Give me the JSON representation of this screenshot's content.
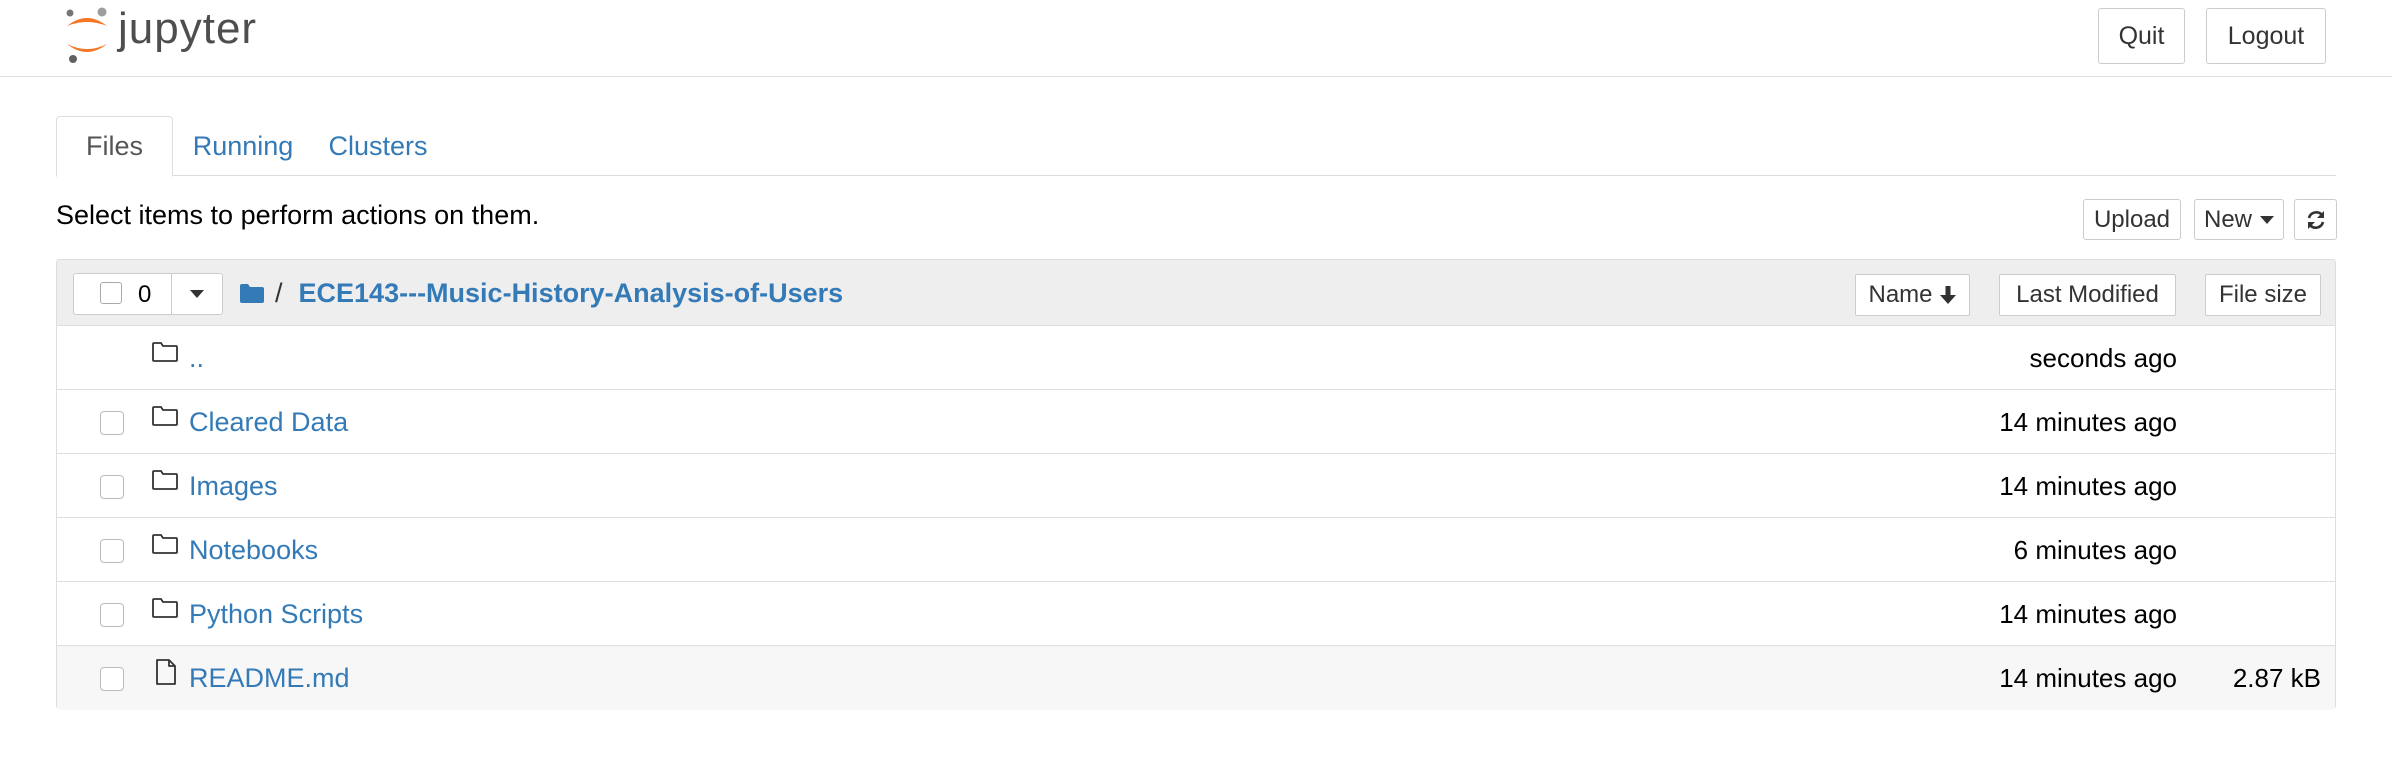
{
  "header": {
    "logo_text": "jupyter",
    "quit_label": "Quit",
    "logout_label": "Logout"
  },
  "tabs": [
    {
      "label": "Files",
      "active": true
    },
    {
      "label": "Running",
      "active": false
    },
    {
      "label": "Clusters",
      "active": false
    }
  ],
  "toolbar": {
    "hint": "Select items to perform actions on them.",
    "upload_label": "Upload",
    "new_label": "New",
    "refresh_icon": "refresh-icon"
  },
  "list_header": {
    "selected_count": "0",
    "breadcrumb_sep": "/",
    "breadcrumb_path": "ECE143---Music-History-Analysis-of-Users",
    "sort_name_label": "Name",
    "sort_modified_label": "Last Modified",
    "sort_size_label": "File size"
  },
  "rows": [
    {
      "name": "..",
      "modified": "seconds ago",
      "size": "",
      "icon": "folder-icon"
    },
    {
      "name": "Cleared Data",
      "modified": "14 minutes ago",
      "size": "",
      "icon": "folder-icon"
    },
    {
      "name": "Images",
      "modified": "14 minutes ago",
      "size": "",
      "icon": "folder-icon"
    },
    {
      "name": "Notebooks",
      "modified": "6 minutes ago",
      "size": "",
      "icon": "folder-icon"
    },
    {
      "name": "Python Scripts",
      "modified": "14 minutes ago",
      "size": "",
      "icon": "folder-icon"
    },
    {
      "name": "README.md",
      "modified": "14 minutes ago",
      "size": "2.87 kB",
      "icon": "file-icon"
    }
  ],
  "colors": {
    "link": "#337ab7",
    "logo_orange": "#f37726",
    "header_bg": "#eeeeee"
  }
}
